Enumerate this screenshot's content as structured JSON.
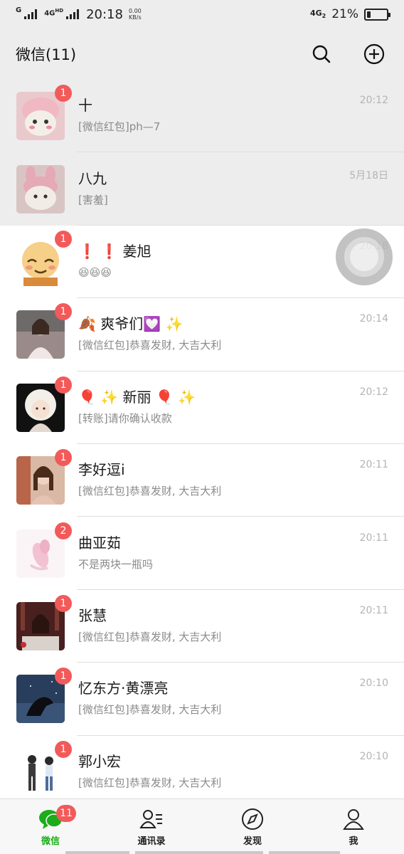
{
  "status_bar": {
    "signal_1": "G",
    "signal_2": "4G",
    "signal_2_sup": "HD",
    "time": "20:18",
    "speed_value": "0.00",
    "speed_unit": "KB/s",
    "network": "4G",
    "network_sub": "2",
    "battery_percent": "21%",
    "battery_level": 0.21
  },
  "header": {
    "title": "微信(11)",
    "search_icon": "search-icon",
    "add_icon": "plus-circle-icon"
  },
  "chats": [
    {
      "name": "十",
      "preview": "[微信红包]ph—7",
      "time": "20:12",
      "badge": "1",
      "pinned": true
    },
    {
      "name": "八九",
      "preview": "[害羞]",
      "time": "5月18日",
      "badge": "",
      "pinned": true
    },
    {
      "name": "❗️ ❗️ 姜旭",
      "preview": "😆😆😆",
      "time": "20:18",
      "badge": "1",
      "pinned": false
    },
    {
      "name": "🍂 爽爷们💟 ✨",
      "preview": "[微信红包]恭喜发财, 大吉大利",
      "time": "20:14",
      "badge": "1",
      "pinned": false
    },
    {
      "name": "🎈 ✨ 新丽 🎈 ✨",
      "preview": "[转账]请你确认收款",
      "time": "20:12",
      "badge": "1",
      "pinned": false
    },
    {
      "name": "李好逗i",
      "preview": "[微信红包]恭喜发财, 大吉大利",
      "time": "20:11",
      "badge": "1",
      "pinned": false
    },
    {
      "name": "曲亚茹",
      "preview": "不是两块一瓶吗",
      "time": "20:11",
      "badge": "2",
      "pinned": false
    },
    {
      "name": "张慧",
      "preview": "[微信红包]恭喜发财, 大吉大利",
      "time": "20:11",
      "badge": "1",
      "pinned": false
    },
    {
      "name": "忆东方·黄漂亮",
      "preview": "[微信红包]恭喜发财, 大吉大利",
      "time": "20:10",
      "badge": "1",
      "pinned": false
    },
    {
      "name": "郭小宏",
      "preview": "[微信红包]恭喜发财, 大吉大利",
      "time": "20:10",
      "badge": "1",
      "pinned": false
    }
  ],
  "tabs": [
    {
      "label": "微信",
      "icon": "chat-bubble-icon",
      "badge": "11",
      "active": true
    },
    {
      "label": "通讯录",
      "icon": "contacts-icon",
      "badge": "",
      "active": false
    },
    {
      "label": "发现",
      "icon": "compass-icon",
      "badge": "",
      "active": false
    },
    {
      "label": "我",
      "icon": "person-icon",
      "badge": "",
      "active": false
    }
  ],
  "colors": {
    "accent_green": "#1aad19",
    "badge_red": "#f25a5a",
    "header_bg": "#ededed",
    "pinned_bg": "#ededed"
  }
}
